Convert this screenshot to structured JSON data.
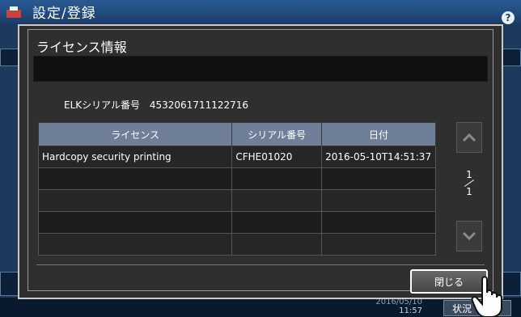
{
  "app": {
    "title": "設定/登録",
    "help": "?"
  },
  "dialog": {
    "title": "ライセンス情報",
    "serial_label": "ELKシリアル番号",
    "serial_value": "4532061711122716",
    "table": {
      "headers": [
        "ライセンス",
        "シリアル番号",
        "日付"
      ],
      "rows": [
        [
          "Hardcopy security printing",
          "CFHE01020",
          "2016-05-10T14:51:37"
        ],
        [
          "",
          "",
          ""
        ],
        [
          "",
          "",
          ""
        ],
        [
          "",
          "",
          ""
        ],
        [
          "",
          "",
          ""
        ]
      ]
    },
    "pager": {
      "current": "1",
      "total": "1"
    },
    "close_label": "閉じる"
  },
  "bottom": {
    "clock_date": "2016/05/10",
    "clock_time": "11:57",
    "status_label": "状況"
  },
  "colors": {
    "header": "#6f7f98",
    "dialog_bg": "#2f2f2f",
    "app_bg": "#1d3a5e"
  },
  "icons": {
    "app": "settings-app-icon",
    "up": "chevron-up-icon",
    "down": "chevron-down-icon",
    "cursor": "hand-pointer-icon"
  }
}
